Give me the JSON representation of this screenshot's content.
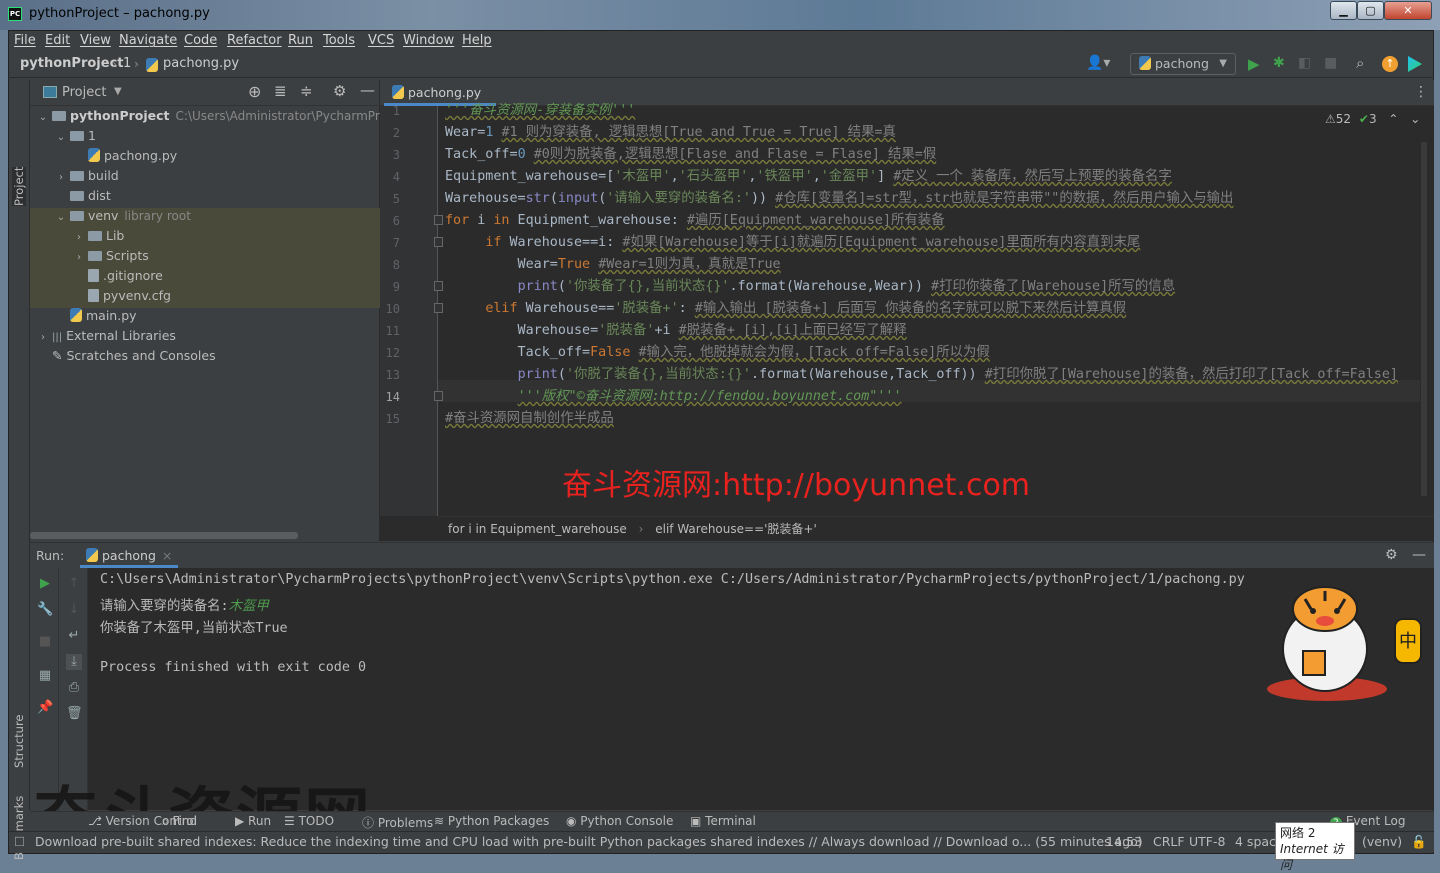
{
  "window": {
    "title": "pythonProject – pachong.py",
    "app_icon": "PC"
  },
  "menu": [
    "File",
    "Edit",
    "View",
    "Navigate",
    "Code",
    "Refactor",
    "Run",
    "Tools",
    "VCS",
    "Window",
    "Help"
  ],
  "breadcrumb": {
    "project": "pythonProject",
    "folder": "1",
    "file": "pachong.py"
  },
  "run_config": {
    "name": "pachong"
  },
  "side_labels": {
    "project": "Project",
    "structure": "Structure",
    "bookmarks": "Bookmarks"
  },
  "project_panel": {
    "title": "Project",
    "tree": [
      {
        "label": "pythonProject",
        "hint": "C:\\Users\\Administrator\\PycharmProjects\\pythonProject",
        "level": 0,
        "type": "folder",
        "expanded": true,
        "bold": true
      },
      {
        "label": "1",
        "level": 1,
        "type": "folder",
        "expanded": true
      },
      {
        "label": "pachong.py",
        "level": 2,
        "type": "py"
      },
      {
        "label": "build",
        "level": 1,
        "type": "folder",
        "expanded": false
      },
      {
        "label": "dist",
        "level": 1,
        "type": "folder"
      },
      {
        "label": "venv",
        "hint": "library root",
        "level": 1,
        "type": "folder",
        "expanded": true,
        "lib": true
      },
      {
        "label": "Lib",
        "level": 2,
        "type": "folder",
        "expanded": false,
        "lib": true
      },
      {
        "label": "Scripts",
        "level": 2,
        "type": "folder",
        "expanded": false,
        "lib": true
      },
      {
        "label": ".gitignore",
        "level": 2,
        "type": "file",
        "lib": true
      },
      {
        "label": "pyvenv.cfg",
        "level": 2,
        "type": "file",
        "lib": true
      },
      {
        "label": "main.py",
        "level": 1,
        "type": "py"
      },
      {
        "label": "External Libraries",
        "level": 0,
        "type": "lib",
        "expanded": false
      },
      {
        "label": "Scratches and Consoles",
        "level": 0,
        "type": "scratch"
      }
    ]
  },
  "editor": {
    "tab": "pachong.py",
    "inspections": {
      "warnings": "52",
      "typos": "3"
    },
    "current_line": 14,
    "lines": [
      [
        [
          "'''奋斗资源网-穿装备实例'''",
          "doc"
        ]
      ],
      [
        [
          "Wear=",
          "p"
        ],
        [
          "1",
          "num"
        ],
        [
          " ",
          "p"
        ],
        [
          "#1 则为穿装备, 逻辑思想[True and True = True] 结果=真",
          "cm"
        ]
      ],
      [
        [
          "Tack_off=",
          "p"
        ],
        [
          "0",
          "num"
        ],
        [
          " ",
          "p"
        ],
        [
          "#0则为脱装备,逻辑思想[Flase and Flase = Flase] 结果=假",
          "cm"
        ]
      ],
      [
        [
          "Equipment_warehouse=[",
          "p"
        ],
        [
          "'木盔甲'",
          "str"
        ],
        [
          ",",
          "p"
        ],
        [
          "'石头盔甲'",
          "str"
        ],
        [
          ",",
          "p"
        ],
        [
          "'铁盔甲'",
          "str"
        ],
        [
          ",",
          "p"
        ],
        [
          "'金盔甲'",
          "str"
        ],
        [
          "] ",
          "p"
        ],
        [
          "#定义 一个 装备库，然后写上预要的装备名字",
          "cm"
        ]
      ],
      [
        [
          "Warehouse=",
          "p"
        ],
        [
          "str",
          "bi"
        ],
        [
          "(",
          "p"
        ],
        [
          "input",
          "bi"
        ],
        [
          "(",
          "p"
        ],
        [
          "'请输入要穿的装备名:'",
          "str"
        ],
        [
          ")) ",
          "p"
        ],
        [
          "#仓库[变量名]=str型，str也就是字符串带\"\"的数据，然后用户输入与输出",
          "cm"
        ]
      ],
      [
        [
          "for",
          "kw"
        ],
        [
          " i ",
          "p"
        ],
        [
          "in",
          "kw"
        ],
        [
          " Equipment_warehouse: ",
          "p"
        ],
        [
          "#遍历[Equipment_warehouse]所有装备",
          "cm"
        ]
      ],
      [
        [
          "     ",
          "p"
        ],
        [
          "if",
          "kw"
        ],
        [
          " Warehouse==i: ",
          "p"
        ],
        [
          "#如果[Warehouse]等于[i]就遍历[Equipment_warehouse]里面所有内容直到末尾",
          "cm"
        ]
      ],
      [
        [
          "         Wear=",
          "p"
        ],
        [
          "True",
          "kw"
        ],
        [
          " ",
          "p"
        ],
        [
          "#Wear=1则为真，真就是True",
          "cm"
        ]
      ],
      [
        [
          "         ",
          "p"
        ],
        [
          "print",
          "bi"
        ],
        [
          "(",
          "p"
        ],
        [
          "'你装备了{},当前状态{}'",
          "str"
        ],
        [
          ".format(Warehouse,Wear)) ",
          "p"
        ],
        [
          "#打印你装备了[Warehouse]所写的信息",
          "cm"
        ]
      ],
      [
        [
          "     ",
          "p"
        ],
        [
          "elif",
          "kw"
        ],
        [
          " Warehouse==",
          "p"
        ],
        [
          "'脱装备+'",
          "str"
        ],
        [
          ": ",
          "p"
        ],
        [
          "#输入输出 [脱装备+] 后面写 你装备的名字就可以脱下来然后计算真假",
          "cm"
        ]
      ],
      [
        [
          "         Warehouse=",
          "p"
        ],
        [
          "'脱装备'",
          "str"
        ],
        [
          "+i ",
          "p"
        ],
        [
          "#脱装备+ [i],[i]上面已经写了解释",
          "cm"
        ]
      ],
      [
        [
          "         Tack_off=",
          "p"
        ],
        [
          "False",
          "kw"
        ],
        [
          " ",
          "p"
        ],
        [
          "#输入完，他脱掉就会为假，[Tack_off=False]所以为假",
          "cm"
        ]
      ],
      [
        [
          "         ",
          "p"
        ],
        [
          "print",
          "bi"
        ],
        [
          "(",
          "p"
        ],
        [
          "'你脱了装备{},当前状态:{}'",
          "str"
        ],
        [
          ".format(Warehouse,Tack_off)) ",
          "p"
        ],
        [
          "#打印你脱了[Warehouse]的装备，然后打印了[Tack_off=False]",
          "cm"
        ]
      ],
      [
        [
          "         ",
          "p"
        ],
        [
          "'''版权\"©奋斗资源网:http://fendou.boyunnet.com\"'''",
          "doc"
        ]
      ],
      [
        [
          "#奋斗资源网自制创作半成品",
          "cm"
        ]
      ]
    ],
    "breadcrumbs": [
      "for i in Equipment_warehouse",
      "elif Warehouse=='脱装备+'"
    ],
    "watermark": "奋斗资源网:http://boyunnet.com"
  },
  "run": {
    "label": "Run:",
    "tab": "pachong",
    "output": [
      {
        "text": "C:\\Users\\Administrator\\PycharmProjects\\pythonProject\\venv\\Scripts\\python.exe C:/Users/Administrator/PycharmProjects/pythonProject/1/pachong.py"
      },
      {
        "text": "请输入要穿的装备名:",
        "input": "木盔甲"
      },
      {
        "text": "你装备了木盔甲,当前状态True"
      },
      {
        "text": ""
      },
      {
        "text": "Process finished with exit code 0"
      }
    ],
    "mascot_text": "中"
  },
  "watermark_big": "奋斗资源网",
  "tool_windows": [
    "Version Control",
    "Find",
    "Run",
    "TODO",
    "Problems",
    "Python Packages",
    "Python Console",
    "Terminal"
  ],
  "event_log": {
    "label": "Event Log",
    "count": "2"
  },
  "status": {
    "message": "Download pre-built shared indexes: Reduce the indexing time and CPU load with pre-built Python packages shared indexes // Always download // Download o... (55 minutes ago)",
    "position": "14:53",
    "line_sep": "CRLF",
    "encoding": "UTF-8",
    "indent": "4 spaces",
    "interpreter": "(venv)"
  },
  "tooltip": {
    "line1": "网络  2",
    "line2": "Internet 访问"
  },
  "colors": {
    "keyword": "#cc7832",
    "string": "#6a8759",
    "number": "#6897bb",
    "comment": "#808080",
    "watermark": "#e8221e",
    "accent": "#4a88c7"
  }
}
